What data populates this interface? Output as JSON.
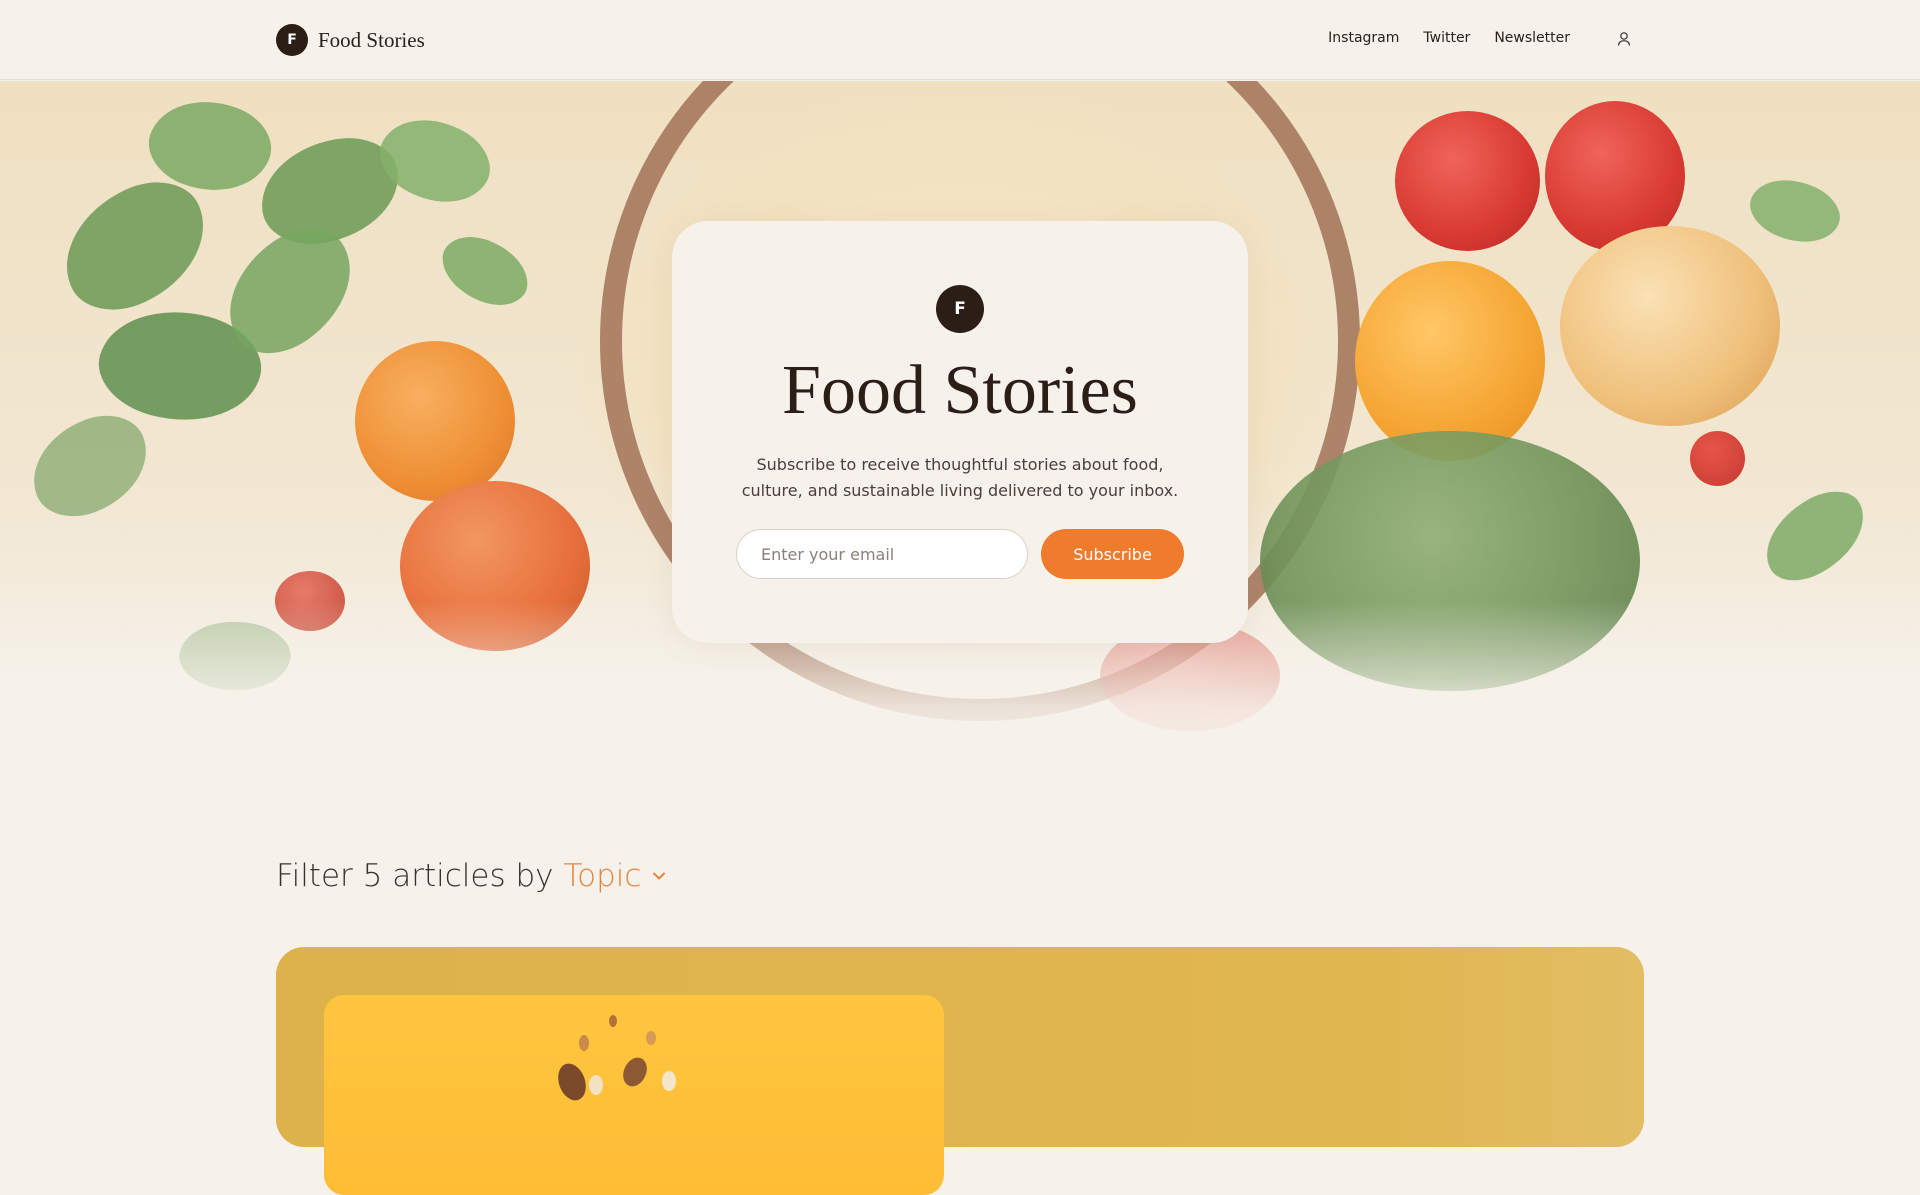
{
  "nav": {
    "brand_mark": "F",
    "brand_name": "Food Stories",
    "links": [
      "Instagram",
      "Twitter",
      "Newsletter"
    ],
    "user_icon": "user-icon"
  },
  "hero": {
    "mark": "F",
    "title": "Food Stories",
    "subtitle": "Subscribe to receive thoughtful stories about food, culture, and sustainable living delivered to your inbox.",
    "email_placeholder": "Enter your email",
    "subscribe_label": "Subscribe"
  },
  "filter": {
    "prefix": "Filter 5 articles by",
    "topic": "Topic",
    "icon": "chevron-down-icon"
  },
  "colors": {
    "accent": "#ef7b2c",
    "topic": "#e2873f",
    "dark": "#2a1e17",
    "background": "#f6f2eb",
    "article_card": "#deb24a"
  }
}
